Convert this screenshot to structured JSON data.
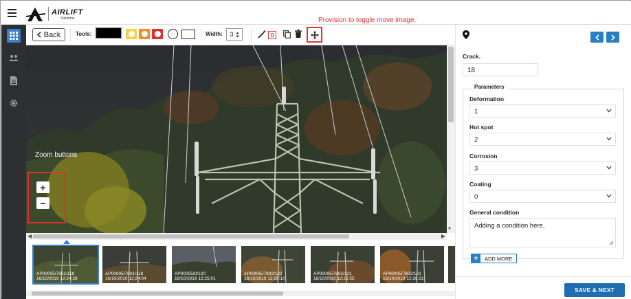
{
  "brand": {
    "name": "AIRLIFT",
    "tagline": "Solutions"
  },
  "annotations": {
    "toggle_move": "Provision to toggle move image.",
    "zoom_buttons": "Zoom buttons"
  },
  "toolbar": {
    "back_label": "Back",
    "tools_label": "Tools:",
    "width_label": "Width:",
    "width_value": "3",
    "annotation_count": "0",
    "swatch_colors": [
      "#000000",
      "#f5d24a",
      "#f28c28",
      "#e03131"
    ]
  },
  "sidebar": {
    "icons": [
      "grid-icon",
      "users-icon",
      "document-icon",
      "gear-icon"
    ]
  },
  "viewer": {
    "zoom_in": "+",
    "zoom_out": "−"
  },
  "thumbnails": [
    {
      "id": "AP00005/7801/119",
      "date": "16/10/2019 12:24:28",
      "selected": true
    },
    {
      "id": "AP00005/7801/118",
      "date": "16/10/2019 12:24:04",
      "selected": false
    },
    {
      "id": "AP00005/0/120",
      "date": "16/10/2019 12:25:01",
      "selected": false
    },
    {
      "id": "AP00005/7802/122",
      "date": "16/10/2019 12:26:10",
      "selected": false
    },
    {
      "id": "AP00005/7802/121",
      "date": "16/10/2019 12:25:55",
      "selected": false
    },
    {
      "id": "AP00005/7802/123",
      "date": "16/10/2019 12:26:31",
      "selected": false
    }
  ],
  "panel": {
    "crack_label": "Crack.",
    "crack_value": "18",
    "parameters_title": "Parameters",
    "fields": [
      {
        "label": "Deformation",
        "value": "1"
      },
      {
        "label": "Hot spot",
        "value": "2"
      },
      {
        "label": "Corrosion",
        "value": "3"
      },
      {
        "label": "Coating",
        "value": "0"
      }
    ],
    "general_condition_label": "General condition",
    "general_condition_value": "Adding a condition here,",
    "add_more_label": "ADD MORE",
    "save_next_label": "SAVE & NEXT",
    "accent": "#2a7fc4"
  }
}
